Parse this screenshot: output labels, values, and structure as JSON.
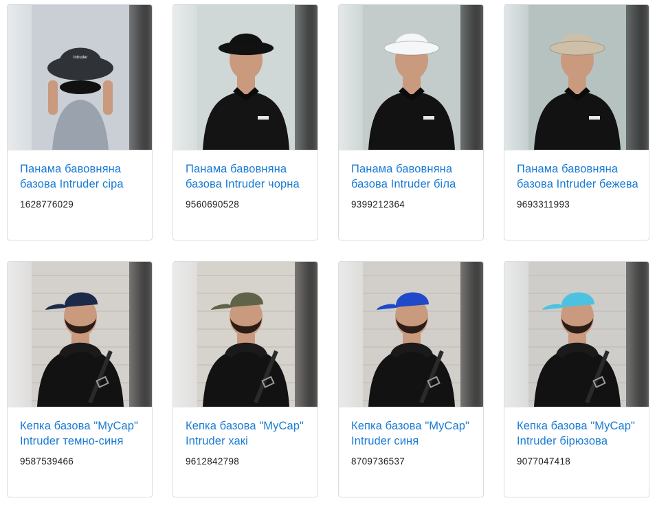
{
  "products": [
    {
      "title": "Панама бавовняна базова Intruder сіра",
      "sku": "1628776029",
      "hat": "bucket",
      "hat_color": "#2f3338",
      "shirt_color": "#9aa3ad",
      "bg_color": "#c9cfd4",
      "logo_text": "Intruder"
    },
    {
      "title": "Панама бавовняна базова Intruder чорна",
      "sku": "9560690528",
      "hat": "bucket",
      "hat_color": "#111111",
      "shirt_color": "#141414",
      "bg_color": "#c7d2cf",
      "logo_text": "Intruder"
    },
    {
      "title": "Панама бавовняна базова Intruder біла",
      "sku": "9399212364",
      "hat": "bucket",
      "hat_color": "#f4f6f8",
      "shirt_color": "#121212",
      "bg_color": "#b9c3c1",
      "logo_text": "Intruder"
    },
    {
      "title": "Панама бавовняна базова Intruder бежева",
      "sku": "9693311993",
      "hat": "bucket",
      "hat_color": "#cdbfa8",
      "shirt_color": "#121212",
      "bg_color": "#a9b8b6",
      "logo_text": "Intruder"
    },
    {
      "title": "Кепка базова \"MyCap\" Intruder темно-синя",
      "sku": "9587539466",
      "hat": "cap",
      "hat_color": "#1c2a4a",
      "shirt_color": "#121212",
      "bg_color": "#d4d0cb"
    },
    {
      "title": "Кепка базова \"MyCap\" Intruder хакі",
      "sku": "9612842798",
      "hat": "cap",
      "hat_color": "#5f6448",
      "shirt_color": "#121212",
      "bg_color": "#d6d2cc"
    },
    {
      "title": "Кепка базова \"MyCap\" Intruder синя",
      "sku": "8709736537",
      "hat": "cap",
      "hat_color": "#1f49c9",
      "shirt_color": "#121212",
      "bg_color": "#d2cfca"
    },
    {
      "title": "Кепка базова \"MyCap\" Intruder бірюзова",
      "sku": "9077047418",
      "hat": "cap",
      "hat_color": "#4cc2e0",
      "shirt_color": "#121212",
      "bg_color": "#cfcdca"
    }
  ]
}
